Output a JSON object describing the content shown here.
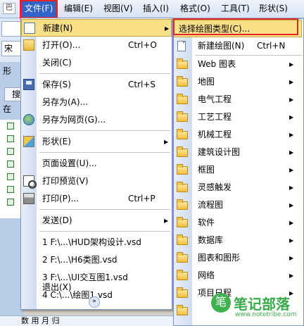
{
  "menubar": {
    "grip_label": "巴",
    "items": [
      {
        "label": "文件(F)",
        "active": true
      },
      {
        "label": "编辑(E)"
      },
      {
        "label": "视图(V)"
      },
      {
        "label": "插入(I)"
      },
      {
        "label": "格式(O)"
      },
      {
        "label": "工具(T)"
      },
      {
        "label": "形状(S)"
      }
    ]
  },
  "background": {
    "toolbar_font": "宋",
    "panel_caption": "形",
    "search_label": "搜",
    "zai_label": "在",
    "bottom_text": "数 用 月 归"
  },
  "file_menu": {
    "items": [
      {
        "label": "新建(N)",
        "icon": "new-doc-icon",
        "highlighted": true,
        "submenu": true
      },
      {
        "label": "打开(O)...",
        "icon": "open-folder-icon",
        "shortcut": "Ctrl+O"
      },
      {
        "label": "关闭(C)"
      },
      {
        "label": "保存(S)",
        "icon": "save-disk-icon",
        "shortcut": "Ctrl+S"
      },
      {
        "label": "另存为(A)..."
      },
      {
        "label": "另存为网页(G)...",
        "icon": "web-page-icon"
      },
      {
        "label": "形状(E)",
        "icon": "shapes-icon",
        "submenu": true
      },
      {
        "label": "页面设置(U)..."
      },
      {
        "label": "打印预览(V)",
        "icon": "print-preview-icon"
      },
      {
        "label": "打印(P)...",
        "icon": "printer-icon",
        "shortcut": "Ctrl+P"
      },
      {
        "label": "发送(D)",
        "submenu": true
      },
      {
        "label": "1 F:\\...\\HUD架构设计.vsd"
      },
      {
        "label": "2 F:\\...\\H6类图.vsd"
      },
      {
        "label": "3 F:\\...\\UI交互图1.vsd"
      },
      {
        "label": "4 C:\\...\\绘图1.vsd"
      },
      {
        "label": "退出(X)"
      }
    ],
    "more_icon": "chevron-double-down-icon"
  },
  "new_menu": {
    "items": [
      {
        "label": "选择绘图类型(C)...",
        "highlighted": true
      },
      {
        "label": "新建绘图(N)",
        "icon": "new-drawing-icon",
        "shortcut": "Ctrl+N"
      },
      {
        "label": "Web 图表",
        "submenu": true
      },
      {
        "label": "地图",
        "submenu": true
      },
      {
        "label": "电气工程",
        "submenu": true
      },
      {
        "label": "工艺工程",
        "submenu": true
      },
      {
        "label": "机械工程",
        "submenu": true
      },
      {
        "label": "建筑设计图",
        "submenu": true
      },
      {
        "label": "框图",
        "submenu": true
      },
      {
        "label": "灵感触发",
        "submenu": true
      },
      {
        "label": "流程图",
        "submenu": true
      },
      {
        "label": "软件",
        "submenu": true
      },
      {
        "label": "数据库",
        "submenu": true
      },
      {
        "label": "图表和图形",
        "submenu": true
      },
      {
        "label": "网络",
        "submenu": true
      },
      {
        "label": "项目日程",
        "submenu": true
      }
    ]
  },
  "watermark": {
    "title": "笔记部落",
    "subtitle": "www.notetribe.com",
    "mark": "笔"
  },
  "colors": {
    "highlight": "#f9df86",
    "active_menu": "#3064c8",
    "annotation_red": "#e3232a"
  }
}
